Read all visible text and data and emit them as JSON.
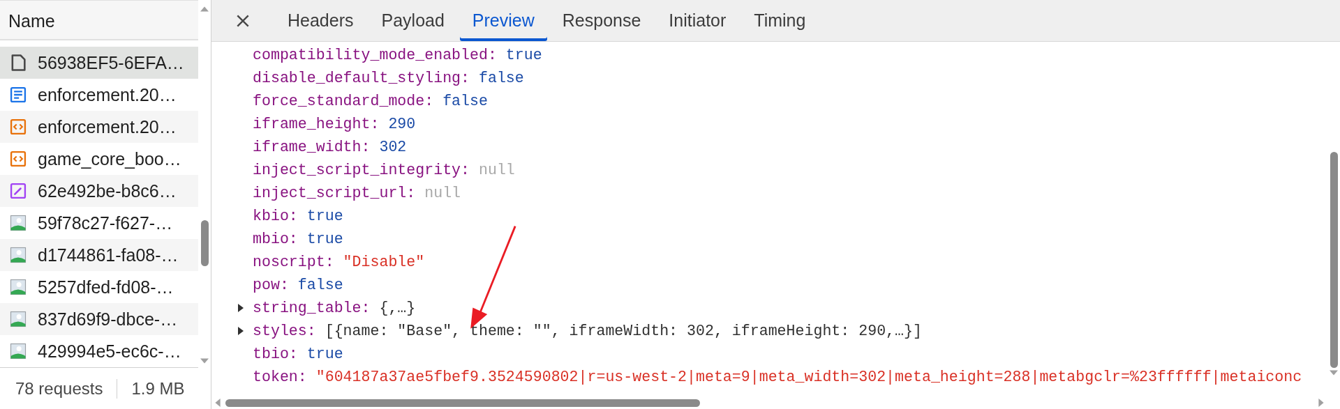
{
  "sidebar": {
    "column_header": "Name",
    "requests": [
      {
        "name": "56938EF5-6EFA…",
        "kind": "file",
        "selected": true
      },
      {
        "name": "enforcement.20…",
        "kind": "doc",
        "selected": false
      },
      {
        "name": "enforcement.20…",
        "kind": "script",
        "selected": false
      },
      {
        "name": "game_core_boo…",
        "kind": "script",
        "selected": false
      },
      {
        "name": "62e492be-b8c6…",
        "kind": "style",
        "selected": false
      },
      {
        "name": "59f78c27-f627-…",
        "kind": "image",
        "selected": false
      },
      {
        "name": "d1744861-fa08-…",
        "kind": "image",
        "selected": false
      },
      {
        "name": "5257dfed-fd08-…",
        "kind": "image",
        "selected": false
      },
      {
        "name": "837d69f9-dbce-…",
        "kind": "image",
        "selected": false
      },
      {
        "name": "429994e5-ec6c-…",
        "kind": "image",
        "selected": false
      }
    ],
    "status_bar": {
      "requests": "78 requests",
      "size": "1.9 MB"
    }
  },
  "tabs": [
    {
      "label": "Headers",
      "selected": false
    },
    {
      "label": "Payload",
      "selected": false
    },
    {
      "label": "Preview",
      "selected": true
    },
    {
      "label": "Response",
      "selected": false
    },
    {
      "label": "Initiator",
      "selected": false
    },
    {
      "label": "Timing",
      "selected": false
    }
  ],
  "preview": [
    {
      "key": "compatibility_mode_enabled:",
      "value": "true",
      "kind": "literal",
      "expandable": false
    },
    {
      "key": "disable_default_styling:",
      "value": "false",
      "kind": "literal",
      "expandable": false
    },
    {
      "key": "force_standard_mode:",
      "value": "false",
      "kind": "literal",
      "expandable": false
    },
    {
      "key": "iframe_height:",
      "value": "290",
      "kind": "literal",
      "expandable": false
    },
    {
      "key": "iframe_width:",
      "value": "302",
      "kind": "literal",
      "expandable": false
    },
    {
      "key": "inject_script_integrity:",
      "value": "null",
      "kind": "null",
      "expandable": false
    },
    {
      "key": "inject_script_url:",
      "value": "null",
      "kind": "null",
      "expandable": false
    },
    {
      "key": "kbio:",
      "value": "true",
      "kind": "literal",
      "expandable": false
    },
    {
      "key": "mbio:",
      "value": "true",
      "kind": "literal",
      "expandable": false
    },
    {
      "key": "noscript:",
      "value": "\"Disable\"",
      "kind": "string",
      "expandable": false
    },
    {
      "key": "pow:",
      "value": "false",
      "kind": "literal",
      "expandable": false
    },
    {
      "key": "string_table:",
      "value": "{,…}",
      "kind": "preview",
      "expandable": true
    },
    {
      "key": "styles:",
      "value": "[{name: \"Base\", theme: \"\", iframeWidth: 302, iframeHeight: 290,…}]",
      "kind": "preview",
      "expandable": true
    },
    {
      "key": "tbio:",
      "value": "true",
      "kind": "literal",
      "expandable": false
    },
    {
      "key": "token:",
      "value": "\"604187a37ae5fbef9.3524590802|r=us-west-2|meta=9|meta_width=302|meta_height=288|metabgclr=%23ffffff|metaiconc",
      "kind": "string",
      "expandable": false
    }
  ]
}
